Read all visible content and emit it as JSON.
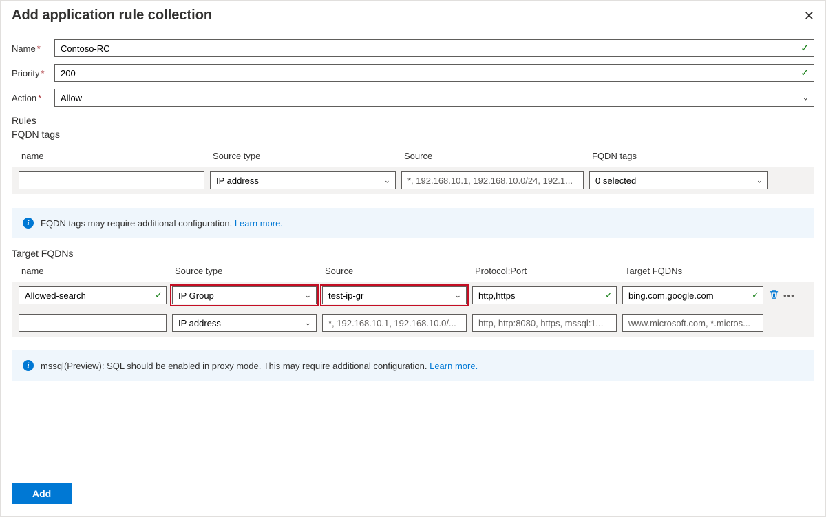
{
  "header": {
    "title": "Add application rule collection"
  },
  "fields": {
    "name_label": "Name",
    "name_value": "Contoso-RC",
    "priority_label": "Priority",
    "priority_value": "200",
    "action_label": "Action",
    "action_value": "Allow"
  },
  "rules_section": "Rules",
  "fqdn_tags": {
    "title": "FQDN tags",
    "headers": {
      "name": "name",
      "source_type": "Source type",
      "source": "Source",
      "tags": "FQDN tags"
    },
    "row": {
      "name": "",
      "source_type": "IP address",
      "source_placeholder": "*, 192.168.10.1, 192.168.10.0/24, 192.1...",
      "tags": "0 selected"
    },
    "info": "FQDN tags may require additional configuration.",
    "learn_more": "Learn more."
  },
  "target_fqdns": {
    "title": "Target FQDNs",
    "headers": {
      "name": "name",
      "source_type": "Source type",
      "source": "Source",
      "protocol": "Protocol:Port",
      "targets": "Target FQDNs"
    },
    "rows": [
      {
        "name": "Allowed-search",
        "source_type": "IP Group",
        "source": "test-ip-gr",
        "protocol": "http,https",
        "targets": "bing.com,google.com",
        "has_actions": true
      },
      {
        "name": "",
        "source_type": "IP address",
        "source_placeholder": "*, 192.168.10.1, 192.168.10.0/...",
        "protocol_placeholder": "http, http:8080, https, mssql:1...",
        "targets_placeholder": "www.microsoft.com, *.micros...",
        "has_actions": false
      }
    ],
    "info": "mssql(Preview): SQL should be enabled in proxy mode. This may require additional configuration.",
    "learn_more": "Learn more."
  },
  "footer": {
    "add": "Add"
  }
}
